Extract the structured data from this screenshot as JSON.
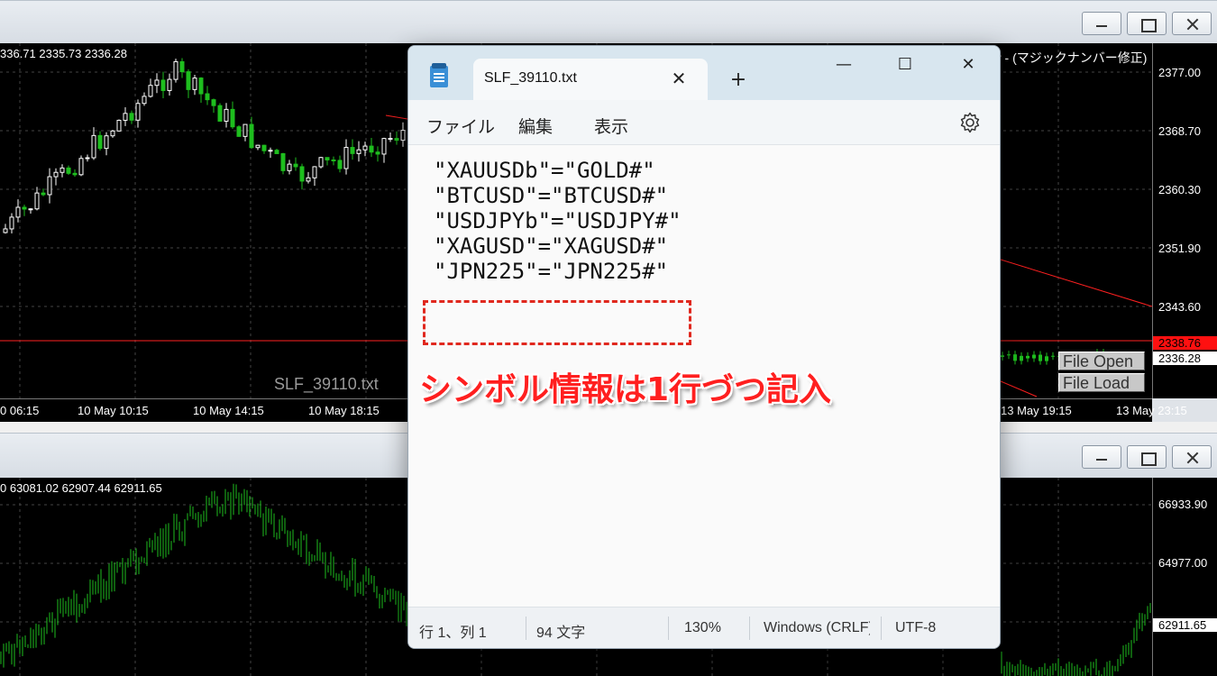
{
  "chart1": {
    "ohlc": "336.71 2335.73 2336.28",
    "prices": [
      "2377.00",
      "2368.70",
      "2360.30",
      "2351.90",
      "2343.60",
      "2336.28",
      "2338.76"
    ],
    "bid_tag": "2338.76",
    "last_tag": "2336.28",
    "scale_bottom": "2336.20",
    "times": [
      "0 06:15",
      "10 May 10:15",
      "10 May 14:15",
      "10 May 18:15",
      "13 May 19:15",
      "13 May 23:15"
    ],
    "chart_name": "SLF_39110.txt",
    "ea_name": "r - (マジックナンバー修正) ☺",
    "buttons": {
      "open": "File Open",
      "load": "File Load"
    }
  },
  "chart2": {
    "ohlc": "0 63081.02 62907.44 62911.65",
    "prices": [
      "66933.90",
      "64977.00",
      "62911.65"
    ],
    "last_tag": "62911.65"
  },
  "notepad": {
    "tab_title": "SLF_39110.txt",
    "close_tab": "✕",
    "new_tab": "+",
    "window": {
      "minimize": "—",
      "maximize": "☐",
      "close": "✕"
    },
    "menu": [
      "ファイル",
      "編集",
      "表示"
    ],
    "lines": [
      "\"XAUUSDb\"=\"GOLD#\"",
      "\"BTCUSD\"=\"BTCUSD#\"",
      "\"USDJPYb\"=\"USDJPY#\"",
      "\"XAGUSD\"=\"XAGUSD#\"",
      "\"JPN225\"=\"JPN225#\""
    ],
    "annotation": "シンボル情報は1行づつ記入",
    "status": {
      "position": "行 1、列 1",
      "chars": "94 文字",
      "zoom": "130%",
      "eol": "Windows (CRLF)",
      "encoding": "UTF-8"
    }
  },
  "colors": {
    "candle_up": "#ffffff",
    "candle_down": "#1ebe1e",
    "bid_line": "#ff2020",
    "annotation": "#ff1f1f",
    "tabbar": "#d8e6ef"
  },
  "icons": [
    "notepad-app-icon",
    "gear-icon",
    "close-icon",
    "plus-icon",
    "minimize-icon",
    "maximize-icon"
  ]
}
